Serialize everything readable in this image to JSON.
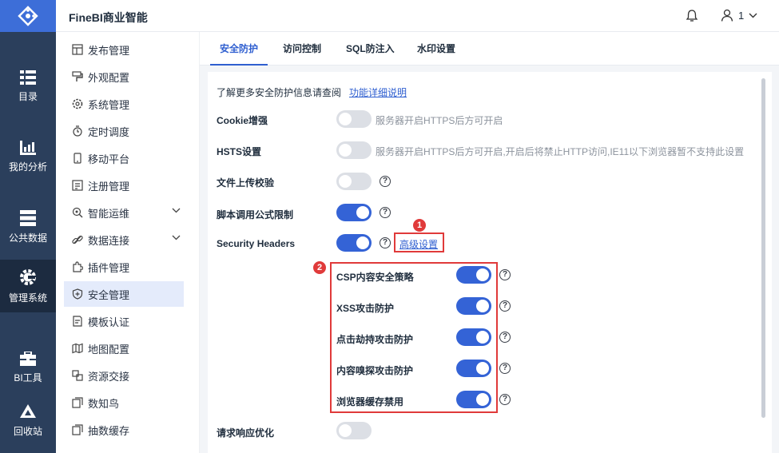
{
  "app": {
    "title": "FineBI商业智能"
  },
  "header": {
    "user_name": "1"
  },
  "rail": [
    {
      "label": "目录",
      "icon": "catalog-icon"
    },
    {
      "label": "我的分析",
      "icon": "analysis-icon"
    },
    {
      "label": "公共数据",
      "icon": "data-icon"
    },
    {
      "label": "管理系统",
      "icon": "gear-icon",
      "active": true
    },
    {
      "label": "BI工具",
      "icon": "toolbox-icon"
    },
    {
      "label": "回收站",
      "icon": "recycle-icon"
    }
  ],
  "menu": [
    {
      "label": "发布管理"
    },
    {
      "label": "外观配置"
    },
    {
      "label": "系统管理"
    },
    {
      "label": "定时调度"
    },
    {
      "label": "移动平台"
    },
    {
      "label": "注册管理"
    },
    {
      "label": "智能运维",
      "expandable": true
    },
    {
      "label": "数据连接",
      "expandable": true
    },
    {
      "label": "插件管理"
    },
    {
      "label": "安全管理",
      "active": true
    },
    {
      "label": "模板认证"
    },
    {
      "label": "地图配置"
    },
    {
      "label": "资源交接"
    },
    {
      "label": "数知鸟"
    },
    {
      "label": "抽数缓存"
    }
  ],
  "tabs": [
    {
      "label": "安全防护",
      "active": true
    },
    {
      "label": "访问控制"
    },
    {
      "label": "SQL防注入"
    },
    {
      "label": "水印设置"
    }
  ],
  "info": {
    "text": "了解更多安全防护信息请查阅",
    "link": "功能详细说明"
  },
  "settings": [
    {
      "label": "Cookie增强",
      "on": false,
      "note": "服务器开启HTTPS后方可开启"
    },
    {
      "label": "HSTS设置",
      "on": false,
      "note": "服务器开启HTTPS后方可开启,开启后将禁止HTTP访问,IE11以下浏览器暂不支持此设置"
    },
    {
      "label": "文件上传校验",
      "on": false
    },
    {
      "label": "脚本调用公式限制",
      "on": true
    },
    {
      "label": "Security Headers",
      "on": true,
      "link": "高级设置"
    }
  ],
  "headers_sub": [
    {
      "label": "CSP内容安全策略",
      "on": true
    },
    {
      "label": "XSS攻击防护",
      "on": true
    },
    {
      "label": "点击劫持攻击防护",
      "on": true
    },
    {
      "label": "内容嗅探攻击防护",
      "on": true
    },
    {
      "label": "浏览器缓存禁用",
      "on": true
    }
  ],
  "response": {
    "label": "请求响应优化",
    "on": false
  },
  "callouts": {
    "one": "1",
    "two": "2"
  },
  "colors": {
    "accent": "#3463d6",
    "rail": "#2b3f5c",
    "callout": "#e03a3a"
  }
}
